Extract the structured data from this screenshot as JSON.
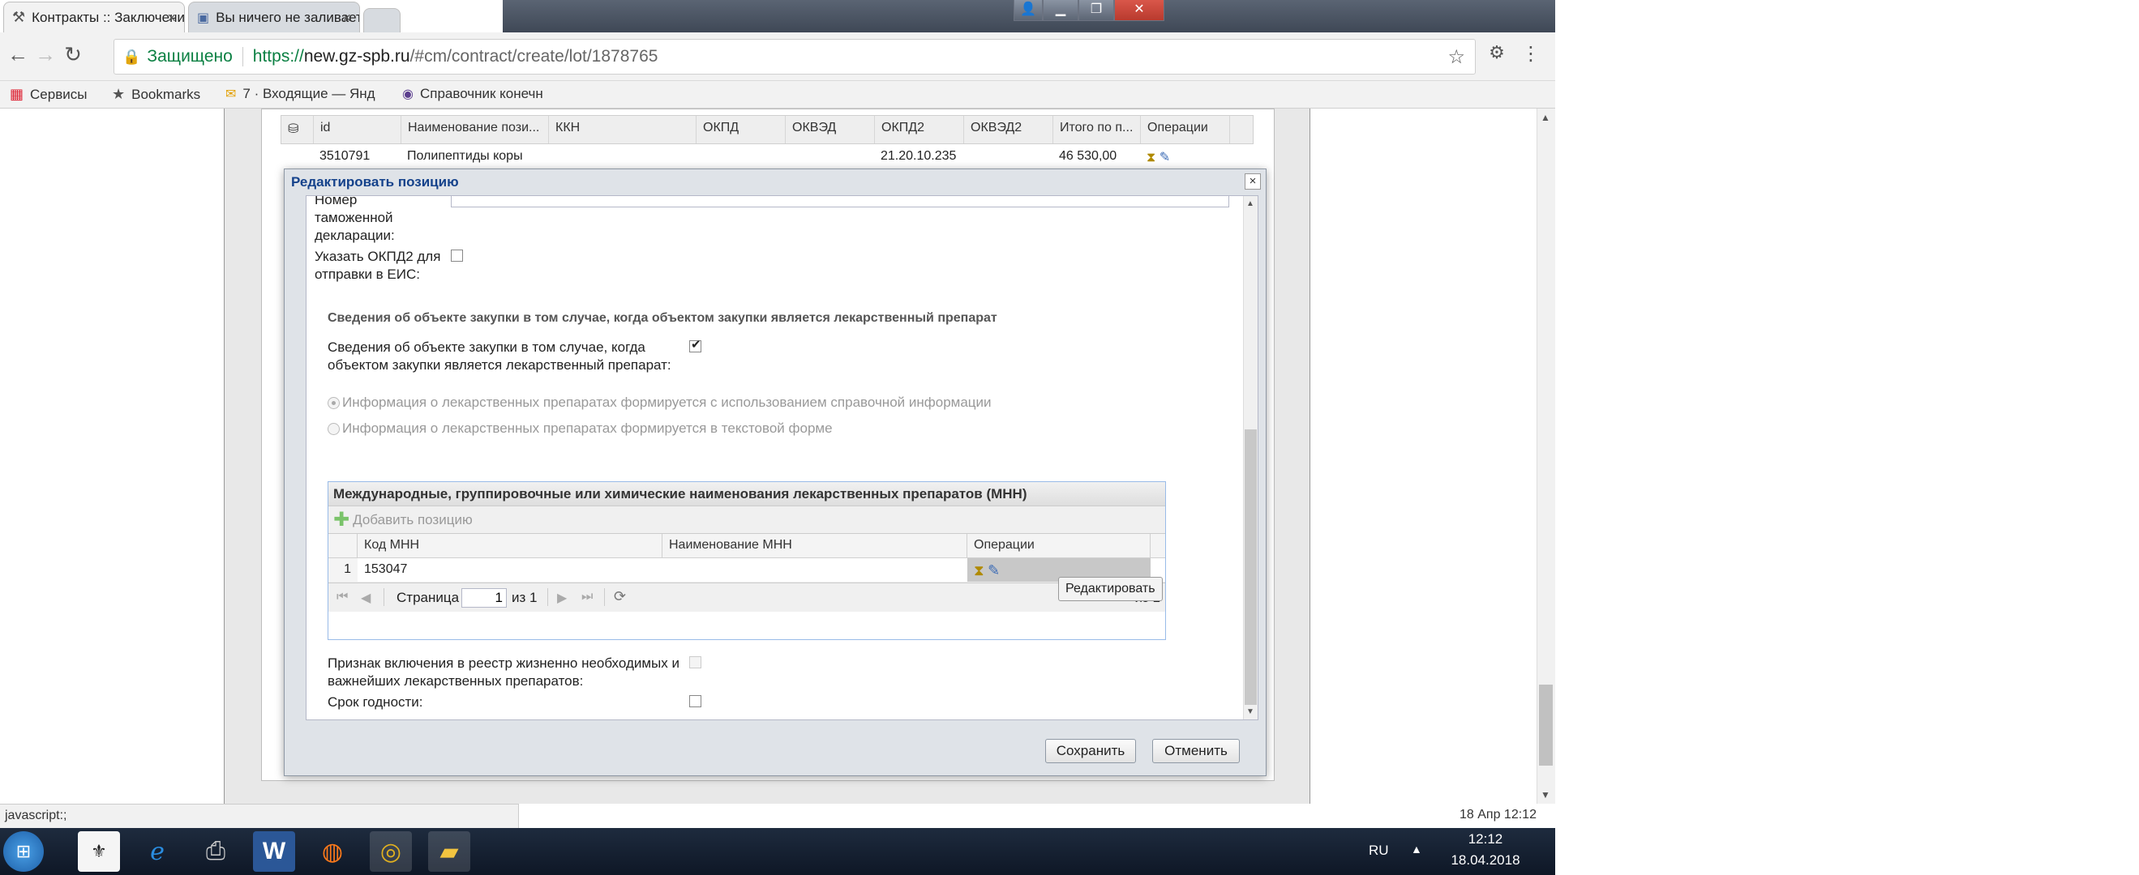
{
  "browser": {
    "tabs": [
      {
        "label": "Контракты :: Заключени",
        "active": true
      },
      {
        "label": "Вы ничего не заливаете",
        "active": false
      }
    ],
    "security_label": "Защищено",
    "url_prefix": "https://",
    "url_host": "new.gz-spb.ru",
    "url_path": "/#cm/contract/create/lot/1878765",
    "bookmarks": [
      {
        "label": "Сервисы",
        "icon": "apps-grid-icon"
      },
      {
        "label": "Bookmarks",
        "icon": "star-icon"
      },
      {
        "label": "7 · Входящие — Янд",
        "icon": "mail-icon"
      },
      {
        "label": "Справочник конечн",
        "icon": "globe-icon"
      }
    ]
  },
  "bg_grid": {
    "columns": [
      "id",
      "Наименование пози...",
      "ККН",
      "ОКПД",
      "ОКВЭД",
      "ОКПД2",
      "ОКВЭД2",
      "Итого по п...",
      "Операции"
    ],
    "row": [
      "3510791",
      "Полипептиды коры",
      "",
      "",
      "",
      "21.20.10.235",
      "",
      "46 530,00",
      ""
    ]
  },
  "dialog": {
    "title": "Редактировать позицию",
    "customs_label": "Номер таможенной декларации:",
    "okpd2_label": "Указать ОКПД2 для отправки в ЕИС:",
    "section_heading": "Сведения об объекте закупки в том случае, когда объектом закупки является лекарственный препарат",
    "drug_checkbox_label": "Сведения об объекте закупки в том случае, когда объектом закупки является лекарственный препарат:",
    "radio_ref": "Информация о лекарственных препаратах формируется с использованием справочной информации",
    "radio_text": "Информация о лекарственных препаратах формируется в текстовой форме",
    "mnn": {
      "title": "Международные, группировочные или химические наименования лекарственных препаратов (МНН)",
      "add_label": "Добавить позицию",
      "columns": [
        "Код МНН",
        "Наименование МНН",
        "Операции"
      ],
      "rows": [
        {
          "num": "1",
          "code": "153047",
          "name": ""
        }
      ],
      "pager_page_label": "Страница",
      "pager_page_value": "1",
      "pager_of": "из 1",
      "pager_right": "из 1"
    },
    "tooltip": "Редактировать",
    "registry_label": "Признак включения в реестр жизненно необходимых и важнейших лекарственных препаратов:",
    "shelf_life_label": "Срок годности:",
    "save_label": "Сохранить",
    "cancel_label": "Отменить"
  },
  "status": {
    "left": "javascript:;",
    "right": "18 Апр 12:12"
  },
  "taskbar": {
    "lang": "RU",
    "time": "12:12",
    "date": "18.04.2018"
  }
}
